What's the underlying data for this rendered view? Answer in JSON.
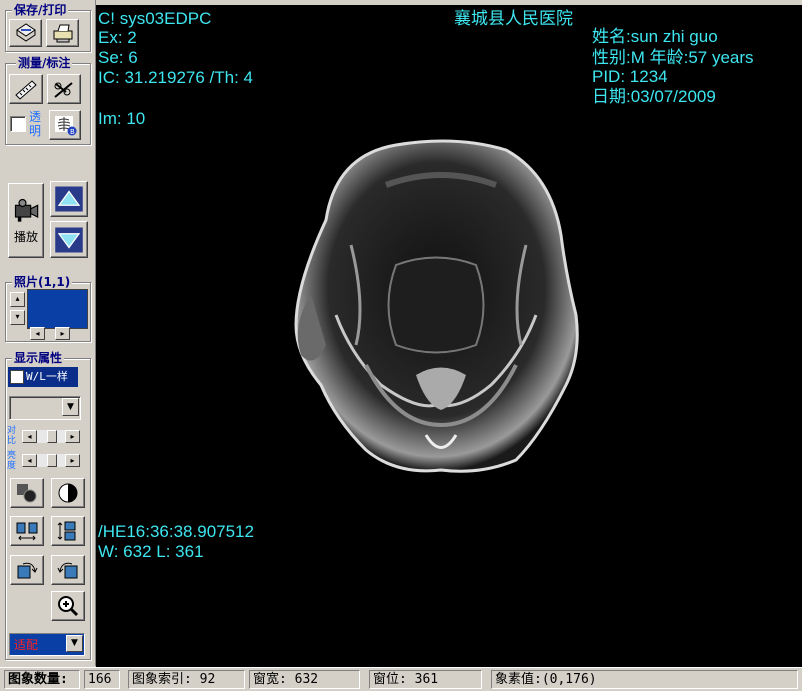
{
  "sidebar": {
    "save_print_title": "保存/打印",
    "measure_title": "测量/标注",
    "transparent_label": "透明",
    "play_label": "播放",
    "photo_title": "照片(1,1)",
    "display_title": "显示属性",
    "wl_same_label": "W/L一样",
    "contrast_label": "对比",
    "brightness_label": "亮度",
    "fit_label": "适配",
    "colors": {
      "accent": "#0a3fa5",
      "title": "#000080",
      "fit_text": "#ff2020"
    }
  },
  "overlay": {
    "modality": "C!  sys03EDPC",
    "exam": "Ex: 2",
    "series": "Se: 6",
    "ic_th": "IC: 31.219276 /Th: 4",
    "image_no": "Im: 10",
    "hospital": "襄城县人民医院",
    "patient_name": "姓名:sun zhi guo",
    "sex_age": "性别:M  年龄:57 years",
    "pid": "PID: 1234",
    "date": "日期:03/07/2009",
    "time": " /HE16:36:38.907512",
    "window_level": "W: 632 L: 361",
    "text_color": "#3ee6f0"
  },
  "status": {
    "image_count_label": "图象数量:",
    "image_count": "166",
    "image_index": "图象索引: 92",
    "window_width": "窗宽: 632",
    "window_level": "窗位: 361",
    "pixel_value": "象素值:(0,176)"
  }
}
